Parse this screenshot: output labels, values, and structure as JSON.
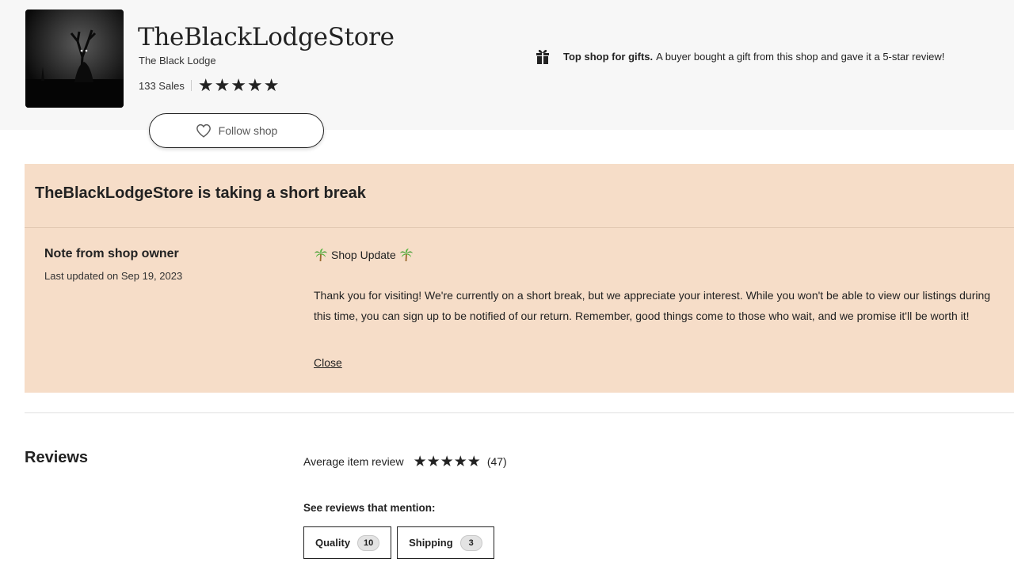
{
  "header": {
    "shop_name": "TheBlackLodgeStore",
    "shop_subtitle": "The Black Lodge",
    "sales": "133 Sales",
    "rating_stars": 5,
    "follow_label": "Follow shop",
    "gift_badge": {
      "strong": "Top shop for gifts.",
      "text": "A buyer bought a gift from this shop and gave it a 5-star review!",
      "icon": "gift-icon"
    }
  },
  "break_notice": {
    "title": "TheBlackLodgeStore is taking a short break",
    "note_title": "Note from shop owner",
    "last_updated": "Last updated on Sep 19, 2023",
    "update_heading": "Shop Update",
    "update_icon": "palm-tree-icon",
    "message": "Thank you for visiting! We're currently on a short break, but we appreciate your interest. While you won't be able to view our listings during this time, you can sign up to be notified of our return. Remember, good things come to those who wait, and we promise it'll be worth it!",
    "close_label": "Close",
    "background": "#f6ddc8"
  },
  "reviews": {
    "title": "Reviews",
    "average_label": "Average item review",
    "average_stars": 5,
    "count": "(47)",
    "mention_label": "See reviews that mention:",
    "chips": [
      {
        "label": "Quality",
        "count": "10"
      },
      {
        "label": "Shipping",
        "count": "3"
      }
    ]
  }
}
